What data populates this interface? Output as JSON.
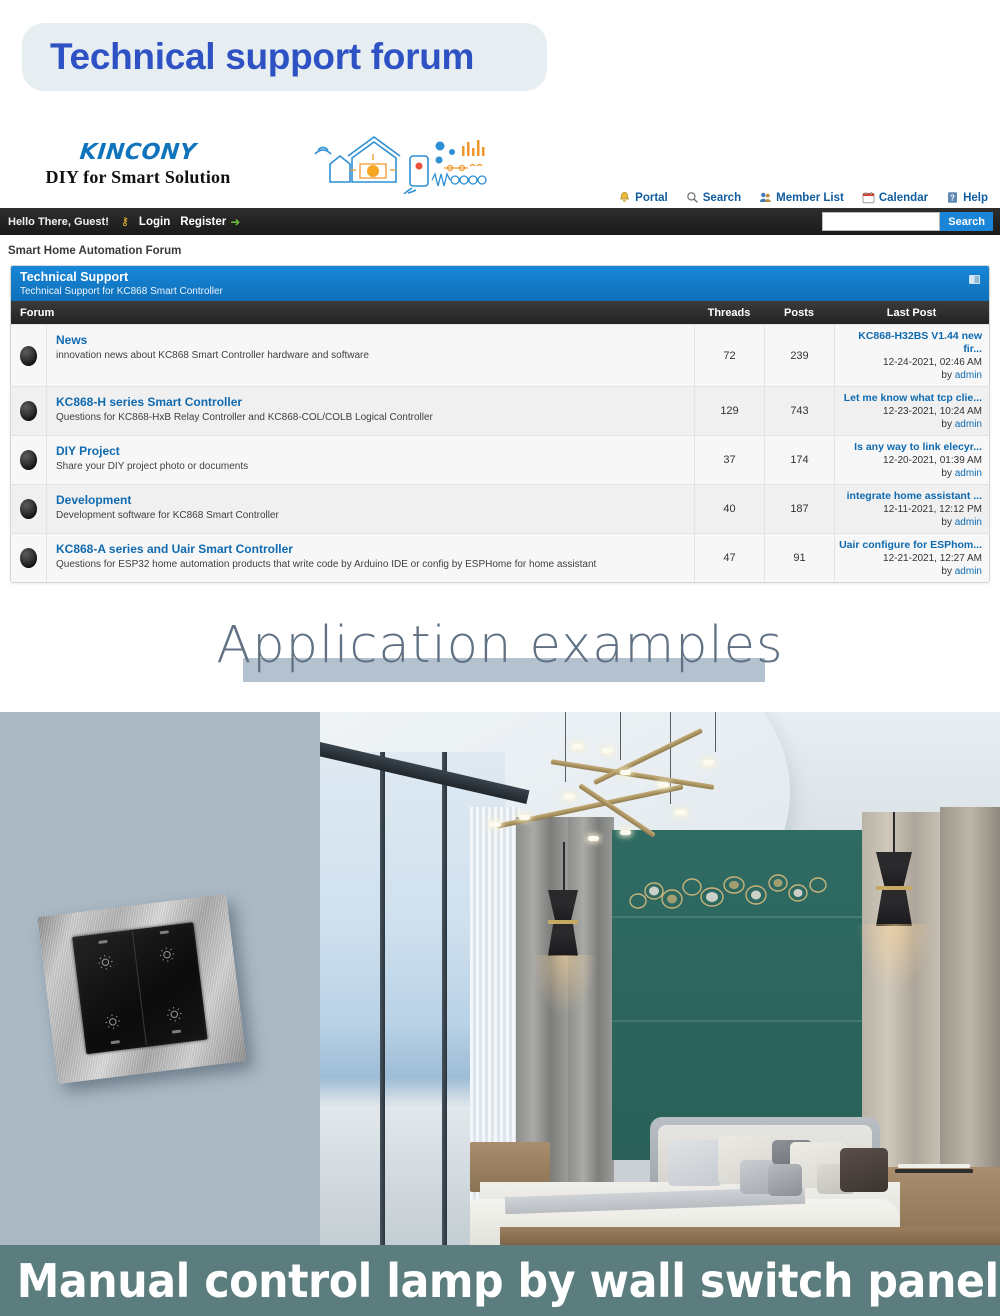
{
  "banner": {
    "title": "Technical support forum"
  },
  "brand": {
    "name": "KINCONY",
    "tagline": "DIY for Smart Solution",
    "art_icon": "smart-home-illustration"
  },
  "nav": {
    "links": [
      {
        "label": "Portal",
        "icon": "bell-icon"
      },
      {
        "label": "Search",
        "icon": "magnifier-icon"
      },
      {
        "label": "Member List",
        "icon": "people-icon"
      },
      {
        "label": "Calendar",
        "icon": "calendar-icon"
      },
      {
        "label": "Help",
        "icon": "help-icon"
      }
    ]
  },
  "userbar": {
    "greeting": "Hello There, Guest!",
    "login": "Login",
    "register": "Register",
    "key_icon": "key-icon",
    "arrow_icon": "arrow-right-icon",
    "search_value": "",
    "search_placeholder": "",
    "search_button": "Search"
  },
  "breadcrumb": "Smart Home Automation Forum",
  "category": {
    "title": "Technical Support",
    "subtitle": "Technical Support for KC868 Smart Controller",
    "toggle_icon": "collapse-icon"
  },
  "table": {
    "columns": {
      "forum": "Forum",
      "threads": "Threads",
      "posts": "Posts",
      "last_post": "Last Post"
    },
    "rows": [
      {
        "title": "News",
        "description": "innovation news about KC868 Smart Controller hardware and software",
        "threads": "72",
        "posts": "239",
        "last_post_title": "KC868-H32BS V1.44 new fir...",
        "last_post_date": "12-24-2021, 02:46 AM",
        "last_post_by": "by ",
        "last_post_author": "admin"
      },
      {
        "title": "KC868-H series Smart Controller",
        "description": "Questions for KC868-HxB Relay Controller and KC868-COL/COLB Logical Controller",
        "threads": "129",
        "posts": "743",
        "last_post_title": "Let me know what tcp clie...",
        "last_post_date": "12-23-2021, 10:24 AM",
        "last_post_by": "by ",
        "last_post_author": "admin"
      },
      {
        "title": "DIY Project",
        "description": "Share your DIY project photo or documents",
        "threads": "37",
        "posts": "174",
        "last_post_title": "Is any way to link elecyr...",
        "last_post_date": "12-20-2021, 01:39 AM",
        "last_post_by": "by ",
        "last_post_author": "admin"
      },
      {
        "title": "Development",
        "description": "Development software for KC868 Smart Controller",
        "threads": "40",
        "posts": "187",
        "last_post_title": "integrate home assistant ...",
        "last_post_date": "12-11-2021, 12:12 PM",
        "last_post_by": "by ",
        "last_post_author": "admin"
      },
      {
        "title": "KC868-A series and Uair Smart Controller",
        "description": "Questions for ESP32 home automation products that write code by Arduino IDE or config by ESPHome for home assistant",
        "threads": "47",
        "posts": "91",
        "last_post_title": "Uair configure for ESPhom...",
        "last_post_date": "12-21-2021, 12:27 AM",
        "last_post_by": "by ",
        "last_post_author": "admin"
      }
    ]
  },
  "application_section": {
    "heading": "Application examples"
  },
  "photos": {
    "left_image_name": "wall-switch-panel-photo",
    "right_image_name": "modern-bedroom-photo"
  },
  "caption": {
    "text": "Manual control lamp by wall switch panel"
  },
  "colors": {
    "banner_bg": "#e7eef1",
    "banner_text": "#2e52c4",
    "brand_blue": "#1074bc",
    "category_header": "#1787d8",
    "link_blue": "#0f6ab0",
    "caption_bg": "#5b7d7d",
    "app_bar": "#b4c1ce",
    "switch_pane_bg": "#abb9c5"
  }
}
